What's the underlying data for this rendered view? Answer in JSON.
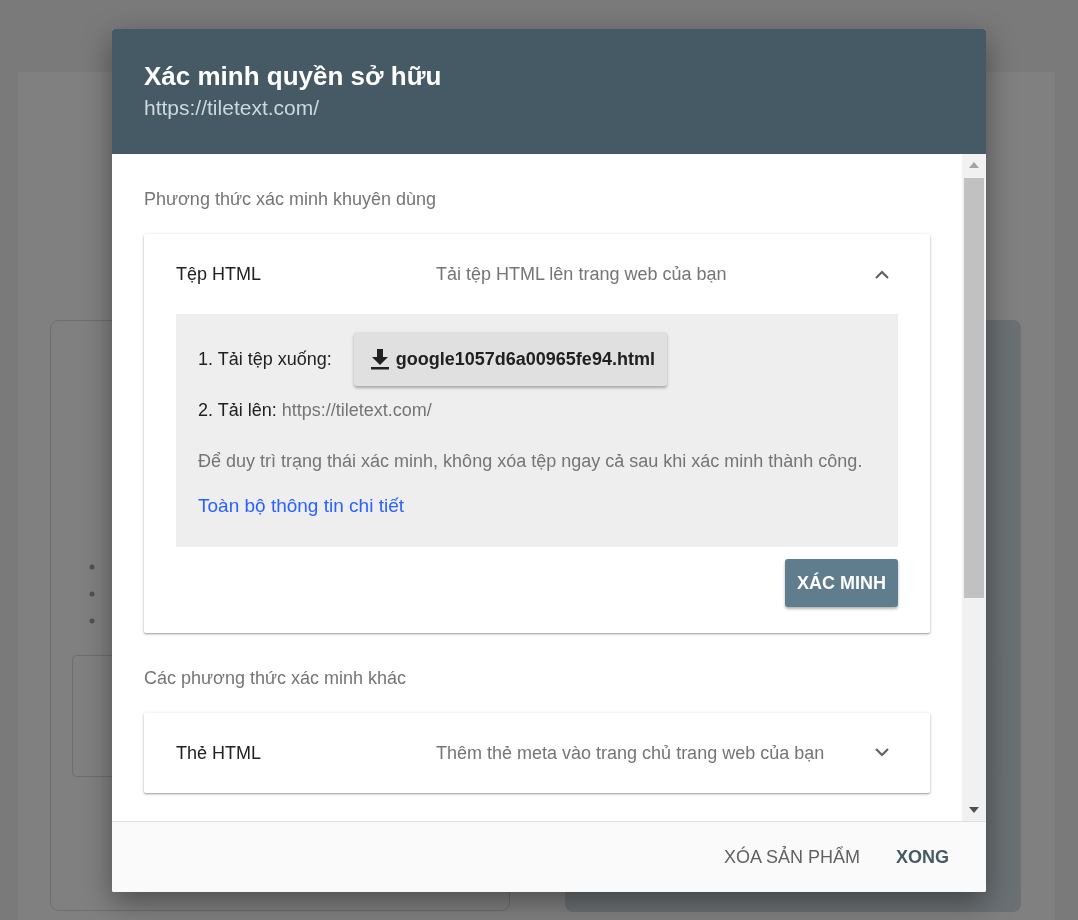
{
  "dialog": {
    "title": "Xác minh quyền sở hữu",
    "subtitle": "https://tiletext.com/"
  },
  "recommended": {
    "heading": "Phương thức xác minh khuyên dùng",
    "methods": [
      {
        "name": "Tệp HTML",
        "description": "Tải tệp HTML lên trang web của bạn",
        "expanded": true,
        "details": {
          "step_1_label": "1. Tải tệp xuống:",
          "download_button": "google1057d6a00965fe94.html",
          "step_2_label": "2. Tải lên:",
          "step_2_url": "https://tiletext.com/",
          "note": "Để duy trì trạng thái xác minh, không xóa tệp ngay cả sau khi xác minh thành công.",
          "link": "Toàn bộ thông tin chi tiết",
          "verify_button": "XÁC MINH"
        }
      }
    ]
  },
  "other": {
    "heading": "Các phương thức xác minh khác",
    "methods": [
      {
        "name": "Thẻ HTML",
        "description": "Thêm thẻ meta vào trang chủ trang web của bạn",
        "expanded": false
      }
    ]
  },
  "footer": {
    "buttons": [
      {
        "label": "XÓA SẢN PHẨM",
        "kind": "secondary"
      },
      {
        "label": "XONG",
        "kind": "primary"
      }
    ]
  }
}
